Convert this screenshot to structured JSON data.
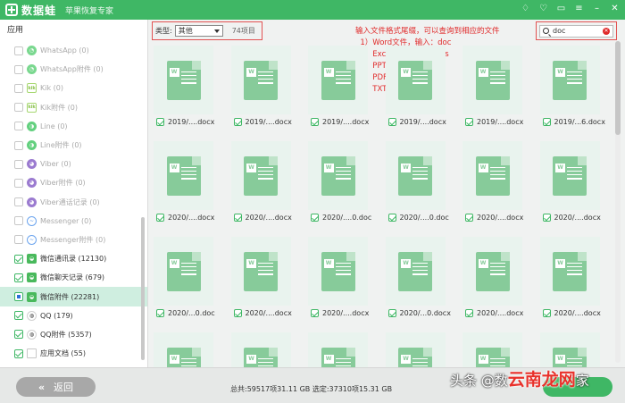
{
  "titlebar": {
    "app_name": "数据蛙",
    "subtitle": "苹果恢复专家",
    "icons": [
      "diamond-icon",
      "heart-icon",
      "chat-icon",
      "menu-icon",
      "minimize-icon",
      "close-icon"
    ]
  },
  "sidebar": {
    "header": "应用",
    "items": [
      {
        "label": "WhatsApp (0)",
        "icon": "whatsapp-icon",
        "state": "off"
      },
      {
        "label": "WhatsApp附件 (0)",
        "icon": "whatsapp-icon",
        "state": "off"
      },
      {
        "label": "Kik (0)",
        "icon": "kik-icon",
        "state": "off"
      },
      {
        "label": "Kik附件 (0)",
        "icon": "kik-icon",
        "state": "off"
      },
      {
        "label": "Line (0)",
        "icon": "line-icon",
        "state": "off"
      },
      {
        "label": "Line附件 (0)",
        "icon": "line-icon",
        "state": "off"
      },
      {
        "label": "Viber (0)",
        "icon": "viber-icon",
        "state": "off"
      },
      {
        "label": "Viber附件 (0)",
        "icon": "viber-icon",
        "state": "off"
      },
      {
        "label": "Viber通话记录 (0)",
        "icon": "viber-icon",
        "state": "off"
      },
      {
        "label": "Messenger (0)",
        "icon": "messenger-icon",
        "state": "off"
      },
      {
        "label": "Messenger附件 (0)",
        "icon": "messenger-icon",
        "state": "off"
      },
      {
        "label": "微信通讯录 (12130)",
        "icon": "wechat-icon",
        "state": "on"
      },
      {
        "label": "微信聊天记录 (679)",
        "icon": "wechat-icon",
        "state": "on"
      },
      {
        "label": "微信附件 (22281)",
        "icon": "wechat-icon",
        "state": "partial",
        "selected": true
      },
      {
        "label": "QQ (179)",
        "icon": "qq-icon",
        "state": "on"
      },
      {
        "label": "QQ附件 (5357)",
        "icon": "qq-icon",
        "state": "on"
      },
      {
        "label": "应用文档 (55)",
        "icon": "document-icon",
        "state": "on"
      }
    ]
  },
  "toolbar": {
    "type_label": "类型:",
    "type_value": "其他",
    "count": "74项目",
    "annotation": "输入文件格式尾缀，可以查询到相应的文件\n  1）Word文件，输入：doc\n  2）Excel文件，输入：xls\n  3）PPT文件，输入：ppt\n  4）PDF文件，输入：pdf\n  5）TXT文件，输入：txt",
    "search_value": "doc"
  },
  "grid": {
    "rows": [
      [
        "2019/....docx",
        "2019/....docx",
        "2019/....docx",
        "2019/....docx",
        "2019/....docx",
        "2019/...6.docx"
      ],
      [
        "2020/....docx",
        "2020/....docx",
        "2020/....0.doc",
        "2020/....0.doc",
        "2020/....docx",
        "2020/....docx"
      ],
      [
        "2020/...0.doc",
        "2020/....docx",
        "2020/....docx",
        "2020/...0.docx",
        "2020/....docx",
        "2020/....docx"
      ],
      [
        "",
        "",
        "",
        "",
        "",
        ""
      ]
    ]
  },
  "footer": {
    "back_label": "返回",
    "totals": "总共:59517项31.11 GB 选定:37310项15.31 GB"
  },
  "watermark": {
    "prefix": "头条 @数",
    "brand": "云南龙网",
    "suffix": "家"
  },
  "colors": {
    "brand_green": "#3fb765",
    "annotation_red": "#e02a2a",
    "selection_bg": "#cfeee0"
  }
}
